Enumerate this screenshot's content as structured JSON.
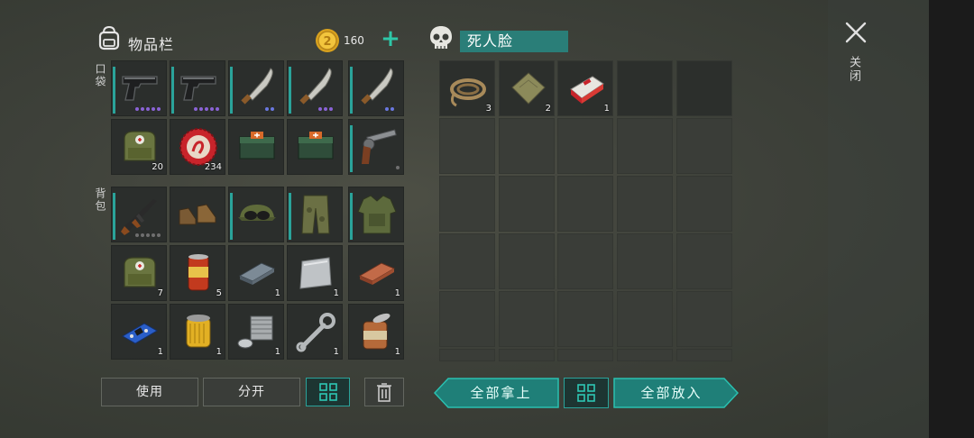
{
  "inventory": {
    "title": "物品栏",
    "coins": "160",
    "plus": "+",
    "sections": {
      "pockets": "口袋",
      "backpack": "背包"
    },
    "pocket_slots": [
      {
        "icon": "pistol-icon",
        "qty": ""
      },
      {
        "icon": "pistol-icon",
        "qty": ""
      },
      {
        "icon": "machete-icon",
        "qty": ""
      },
      {
        "icon": "machete-icon",
        "qty": ""
      },
      {
        "icon": "machete-icon",
        "qty": ""
      },
      {
        "icon": "medkit-bag-icon",
        "qty": "20"
      },
      {
        "icon": "bottle-cap-icon",
        "qty": "234"
      },
      {
        "icon": "first-aid-box-icon",
        "qty": ""
      },
      {
        "icon": "first-aid-box-icon",
        "qty": ""
      },
      {
        "icon": "revolver-icon",
        "qty": ""
      }
    ],
    "backpack_slots": [
      {
        "icon": "assault-rifle-icon",
        "qty": ""
      },
      {
        "icon": "boots-icon",
        "qty": ""
      },
      {
        "icon": "cap-goggles-icon",
        "qty": ""
      },
      {
        "icon": "camo-pants-icon",
        "qty": ""
      },
      {
        "icon": "body-armor-icon",
        "qty": ""
      },
      {
        "icon": "medkit-bag-icon",
        "qty": "7"
      },
      {
        "icon": "food-can-icon",
        "qty": "5"
      },
      {
        "icon": "iron-bar-icon",
        "qty": "1"
      },
      {
        "icon": "aluminum-sheet-icon",
        "qty": "1"
      },
      {
        "icon": "copper-bar-icon",
        "qty": "1"
      },
      {
        "icon": "circuit-board-icon",
        "qty": "1"
      },
      {
        "icon": "oil-filter-icon",
        "qty": "1"
      },
      {
        "icon": "engine-part-icon",
        "qty": "1"
      },
      {
        "icon": "wrench-icon",
        "qty": "1"
      },
      {
        "icon": "open-can-icon",
        "qty": "1"
      }
    ],
    "buttons": {
      "use": "使用",
      "split": "分开"
    }
  },
  "loot": {
    "name": "死人脸",
    "slots": [
      {
        "icon": "rope-icon",
        "qty": "3"
      },
      {
        "icon": "cloth-icon",
        "qty": "2"
      },
      {
        "icon": "cigarettes-icon",
        "qty": "1"
      }
    ],
    "buttons": {
      "take_all": "全部拿上",
      "put_all": "全部放入"
    }
  },
  "close": {
    "label": "关闭"
  },
  "colors": {
    "accent": "#2ac0b0",
    "accent_dark": "#1f7f78",
    "rarity_purple": "#8a63d6"
  }
}
